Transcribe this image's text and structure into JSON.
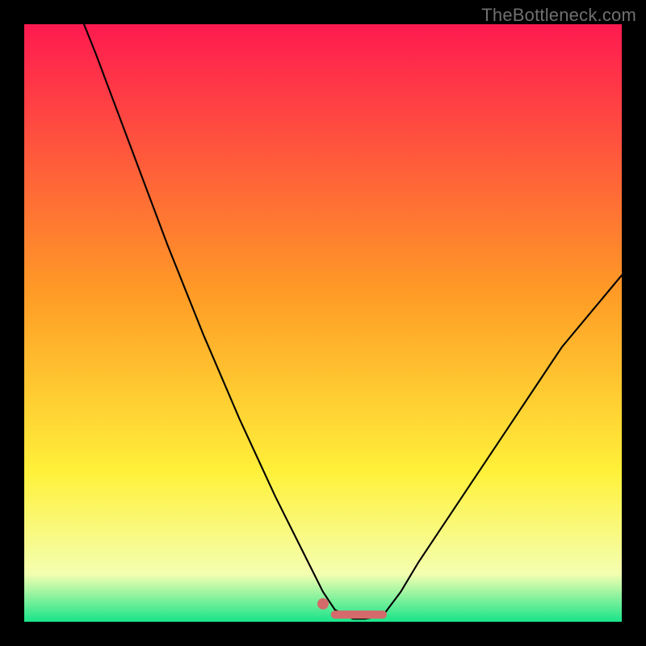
{
  "watermark": "TheBottleneck.com",
  "colors": {
    "frame_bg": "#000000",
    "grad_top": "#ff1a50",
    "grad_mid1": "#ff9b26",
    "grad_mid2": "#fff13a",
    "grad_mid3": "#f4ffb0",
    "grad_bottom": "#18e48a",
    "curve": "#000000",
    "marker": "#d46a6a"
  },
  "chart_data": {
    "type": "line",
    "title": "",
    "xlabel": "",
    "ylabel": "",
    "xlim": [
      0,
      100
    ],
    "ylim": [
      0,
      100
    ],
    "grid": false,
    "legend": false,
    "x": [
      10,
      12,
      15,
      18,
      21,
      24,
      27,
      30,
      33,
      36,
      39,
      42,
      45,
      48,
      50,
      52,
      55,
      57,
      60,
      63,
      66,
      70,
      74,
      78,
      82,
      86,
      90,
      95,
      100
    ],
    "values": [
      100,
      95,
      87,
      79,
      71,
      63,
      55.5,
      48,
      41,
      34,
      27.5,
      21,
      15,
      9,
      5,
      2,
      0.5,
      0.5,
      1,
      5,
      10,
      16,
      22,
      28,
      34,
      40,
      46,
      52,
      58
    ],
    "series": [
      {
        "name": "bottleneck-curve",
        "x": [
          10,
          12,
          15,
          18,
          21,
          24,
          27,
          30,
          33,
          36,
          39,
          42,
          45,
          48,
          50,
          52,
          55,
          57,
          60,
          63,
          66,
          70,
          74,
          78,
          82,
          86,
          90,
          95,
          100
        ],
        "y": [
          100,
          95,
          87,
          79,
          71,
          63,
          55.5,
          48,
          41,
          34,
          27.5,
          21,
          15,
          9,
          5,
          2,
          0.5,
          0.5,
          1,
          5,
          10,
          16,
          22,
          28,
          34,
          40,
          46,
          52,
          58
        ]
      }
    ],
    "marker": {
      "name": "optimal-zone",
      "color": "#d46a6a",
      "dot": {
        "x": 50,
        "y": 3
      },
      "segment": {
        "x0": 52,
        "y0": 1.2,
        "x1": 60,
        "y1": 1.2
      }
    }
  }
}
